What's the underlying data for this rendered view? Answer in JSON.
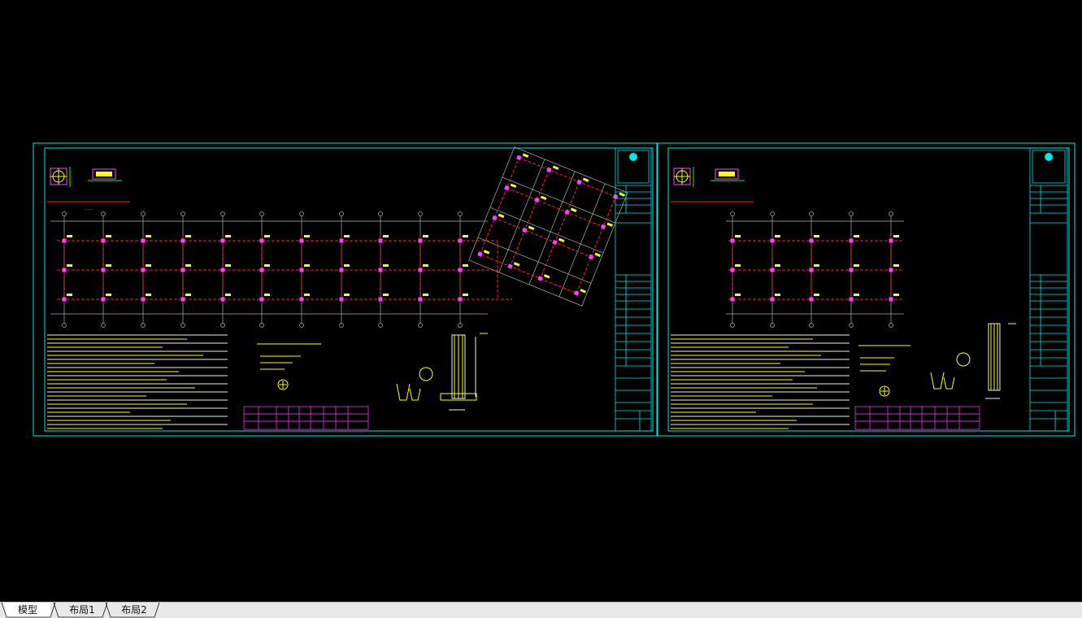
{
  "drawing": {
    "background": "#000000",
    "frame_color": "#00e5e5",
    "axis_color": "#9fb6a8",
    "beam_color": "#ff1e28",
    "column_color": "#ff40ff",
    "label_color": "#ffff00",
    "text_color": "#f0f0f0"
  },
  "tabs": [
    {
      "label": "模型",
      "active": true
    },
    {
      "label": "布局1",
      "active": false
    },
    {
      "label": "布局2",
      "active": false
    }
  ]
}
